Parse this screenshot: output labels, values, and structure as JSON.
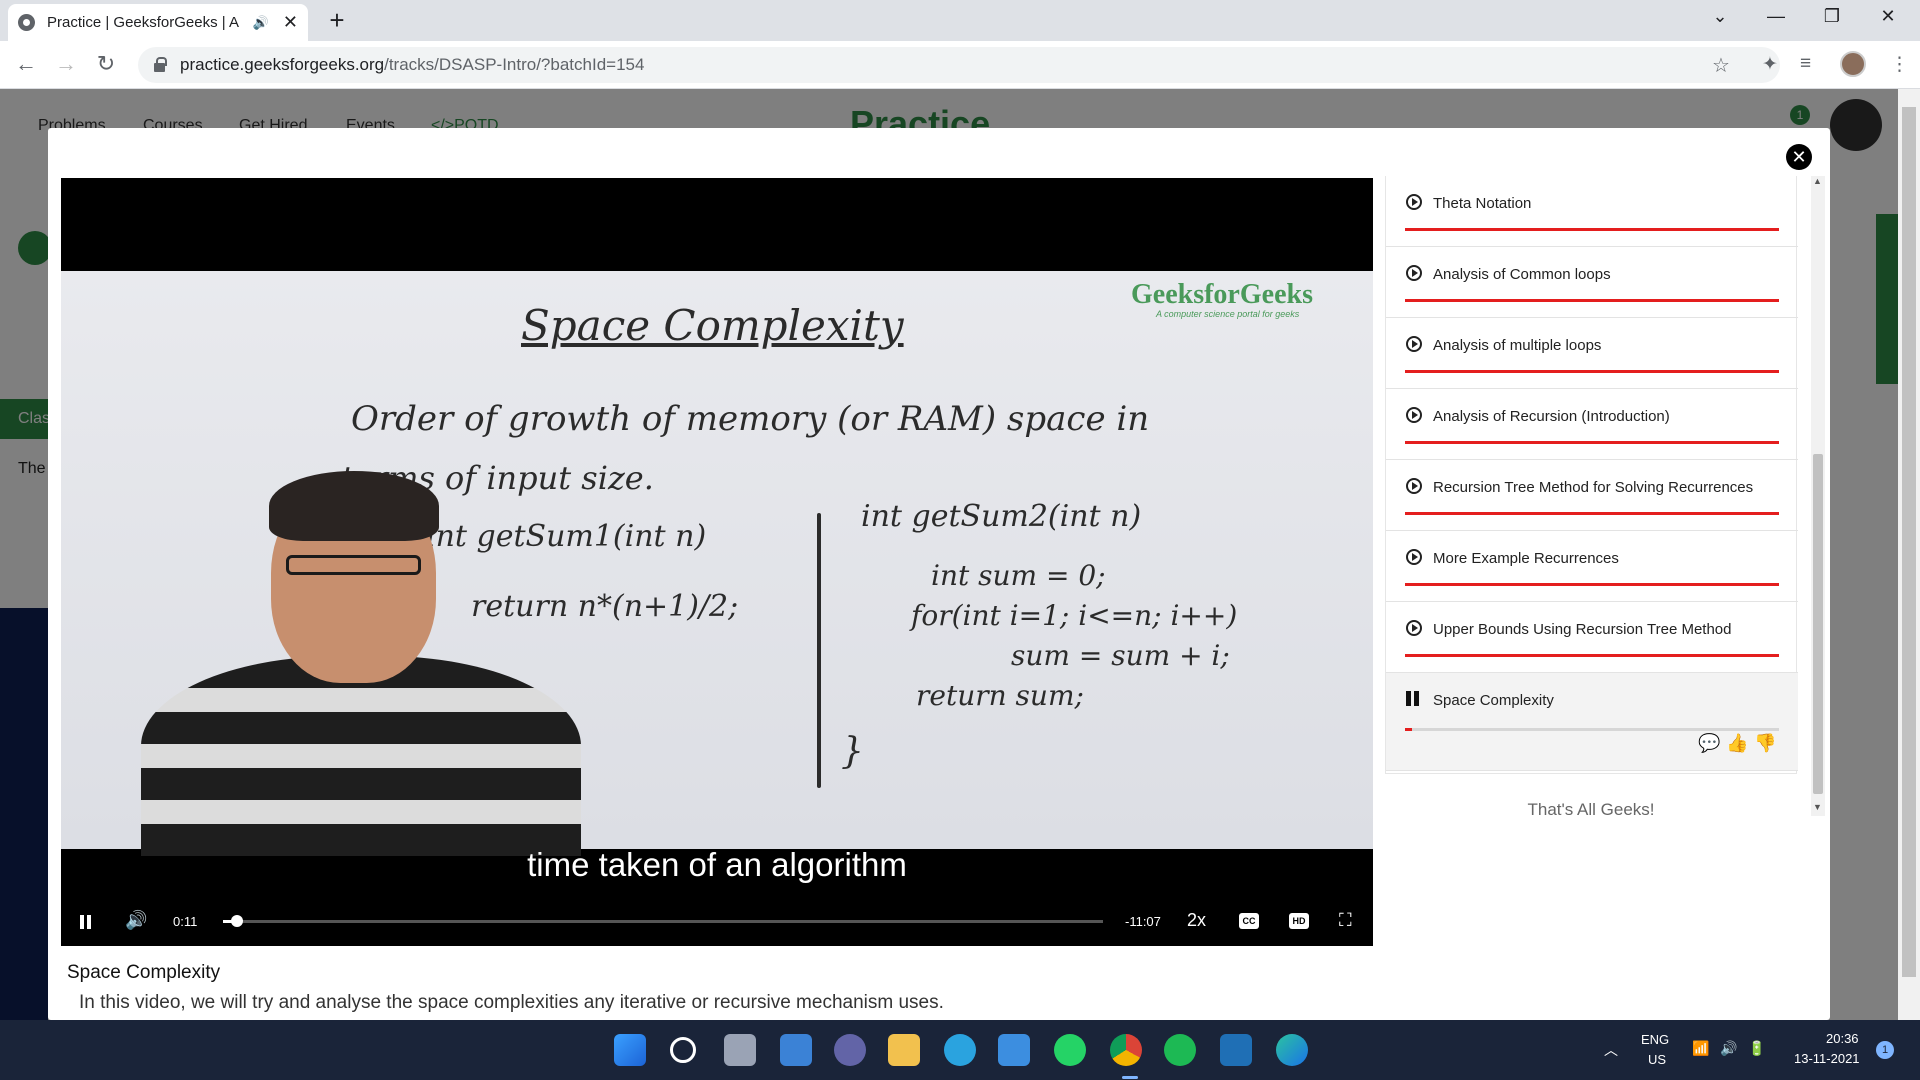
{
  "browser": {
    "tab_title": "Practice | GeeksforGeeks | A",
    "url_host": "practice.geeksforgeeks.org",
    "url_path": "/tracks/DSASP-Intro/?batchId=154"
  },
  "site": {
    "nav": [
      "Problems",
      "Courses",
      "Get Hired",
      "Events",
      "</>POTD"
    ],
    "logo": "Practice",
    "notification_count": "1",
    "side_labels": [
      "Clas",
      "The"
    ]
  },
  "video": {
    "watermark": "GeeksforGeeks",
    "watermark_sub": "A computer science portal for geeks",
    "subtitle": "time taken of an algorithm",
    "current_time": "0:11",
    "remaining_time": "-11:07",
    "speed": "2x",
    "progress": 0.016,
    "board": {
      "title": "Space Complexity",
      "line1": "Order of growth of memory (or RAM) space in",
      "line2": "terms of input size.",
      "f1": "int getSum1(int n)",
      "f2": "return n*(n+1)/2;",
      "g1": "int getSum2(int n)",
      "g2": "int sum = 0;",
      "g3": "for(int i=1; i<=n; i++)",
      "g4": "sum = sum + i;",
      "g5": "return sum;",
      "brace": "}"
    }
  },
  "video_info": {
    "title": "Space Complexity",
    "description": "In this video, we will try and analyse the space complexities any iterative or recursive mechanism uses."
  },
  "playlist": {
    "items": [
      {
        "label": "Theta Notation"
      },
      {
        "label": "Analysis of Common loops"
      },
      {
        "label": "Analysis of multiple loops"
      },
      {
        "label": "Analysis of Recursion (Introduction)"
      },
      {
        "label": "Recursion Tree Method for Solving Recurrences"
      },
      {
        "label": "More Example Recurrences"
      },
      {
        "label": "Upper Bounds Using Recursion Tree Method"
      }
    ],
    "active": {
      "label": "Space Complexity",
      "progress": 0.02
    },
    "footer": "That's All Geeks!"
  },
  "taskbar": {
    "lang": "ENG",
    "region": "US",
    "time": "20:36",
    "date": "13-11-2021",
    "notif": "1"
  },
  "colors": {
    "accent_red": "#e41e1e",
    "gfg_green": "#2f8d46",
    "taskbar": "#1a2439"
  }
}
